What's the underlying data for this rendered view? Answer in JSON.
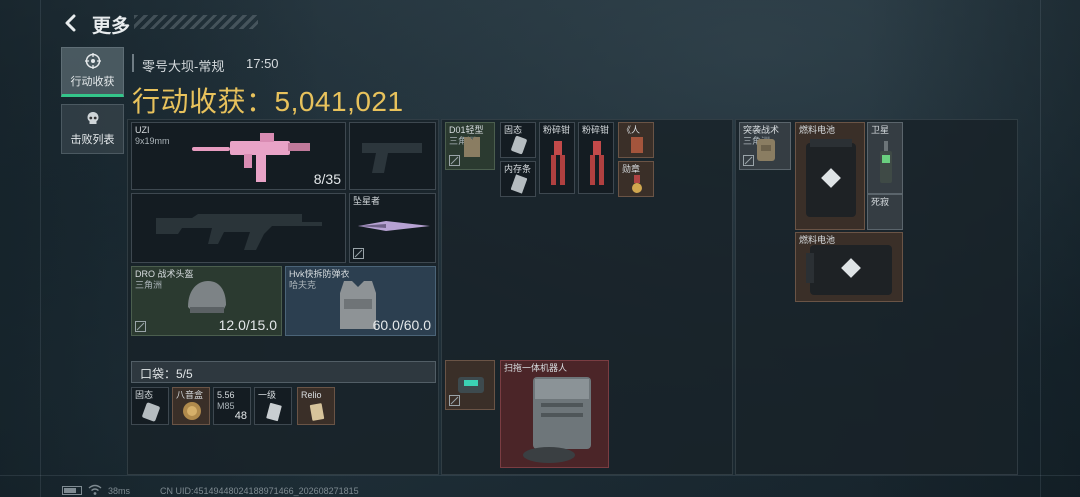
{
  "header": {
    "title": "更多"
  },
  "tabs": [
    {
      "label": "行动收获",
      "icon": "crosshair-icon",
      "active": true
    },
    {
      "label": "击败列表",
      "icon": "skull-icon",
      "active": false
    }
  ],
  "info": {
    "map": "零号大坝-常规",
    "time": "17:50"
  },
  "loot": {
    "value": "行动收获：5,041,021"
  },
  "equipment": {
    "primary": {
      "name": "UZI",
      "caliber": "9x19mm",
      "ammo": "8/35"
    },
    "melee": {
      "name": "坠星者"
    },
    "helmet": {
      "name": "DRO 战术头盔",
      "brand": "三角洲",
      "durability": "12.0/15.0"
    },
    "armor": {
      "name": "Hvk快拆防弹衣",
      "brand": "哈夫克",
      "durability": "60.0/60.0"
    }
  },
  "pockets": {
    "label": "口袋：5/5",
    "items": [
      {
        "name": "固态"
      },
      {
        "name": "八音盒"
      },
      {
        "name": "5.56",
        "sub": "M85",
        "count": "48"
      },
      {
        "name": "一级"
      },
      {
        "name": "Relio"
      }
    ]
  },
  "chest": {
    "items": [
      {
        "name": "D01轻型",
        "sub": "三角洲"
      },
      {
        "name": "固态"
      },
      {
        "name": "粉碎钳"
      },
      {
        "name": "粉碎钳"
      },
      {
        "name": "《人"
      },
      {
        "name": "内存条"
      },
      {
        "name": "勋章"
      }
    ]
  },
  "backpack_small": {
    "name": ""
  },
  "robot": {
    "name": "扫拖一体机器人"
  },
  "backpack": {
    "pack": {
      "name": "突袭战术",
      "sub": "三角洲"
    },
    "battery1": {
      "name": "燃料电池"
    },
    "battery2": {
      "name": "燃料电池"
    },
    "satphone": {
      "name": "卫星"
    },
    "deadtag": {
      "name": "死寂"
    }
  },
  "footer": {
    "ping": "38ms",
    "uid": "CN UID:45149448024188971466_202608271815"
  },
  "colors": {
    "accent": "#34c58a",
    "gold": "#e8c25c"
  }
}
